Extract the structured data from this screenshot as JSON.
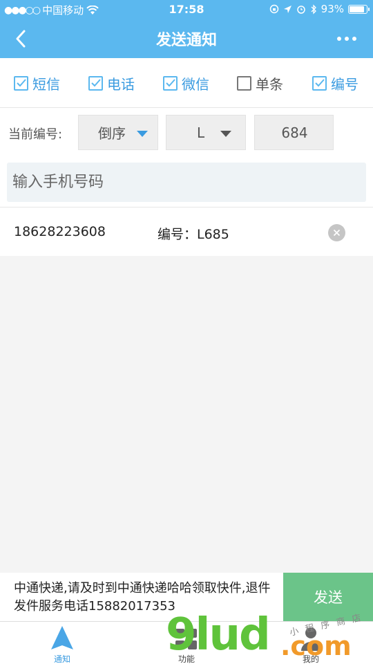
{
  "status_bar": {
    "signal": "●●●○○",
    "carrier": "中国移动",
    "time": "17:58",
    "battery": "93%",
    "battery_level": 0.93
  },
  "nav": {
    "title": "发送通知"
  },
  "options": [
    {
      "label": "短信",
      "checked": true
    },
    {
      "label": "电话",
      "checked": true
    },
    {
      "label": "微信",
      "checked": true
    },
    {
      "label": "单条",
      "checked": false
    },
    {
      "label": "编号",
      "checked": true
    }
  ],
  "number_settings": {
    "label": "当前编号:",
    "order": "倒序",
    "prefix": "L",
    "current_number": "684"
  },
  "phone_input": {
    "value": "",
    "placeholder": "输入手机号码"
  },
  "records": [
    {
      "phone": "18628223608",
      "code": "编号：L685"
    }
  ],
  "message": {
    "text": "中通快递,请及时到中通快递哈哈领取快件,退件发件服务电话15882017353",
    "send_label": "发送"
  },
  "tabs": [
    {
      "label": "通知",
      "active": true
    },
    {
      "label": "功能",
      "active": false
    },
    {
      "label": "我的",
      "active": false
    }
  ],
  "watermark": {
    "main": "9lud",
    "suffix": ".com",
    "sub": "小程序商店"
  },
  "colors": {
    "primary": "#5bb8ef",
    "send": "#6bc489",
    "background": "#f4f4f4"
  }
}
